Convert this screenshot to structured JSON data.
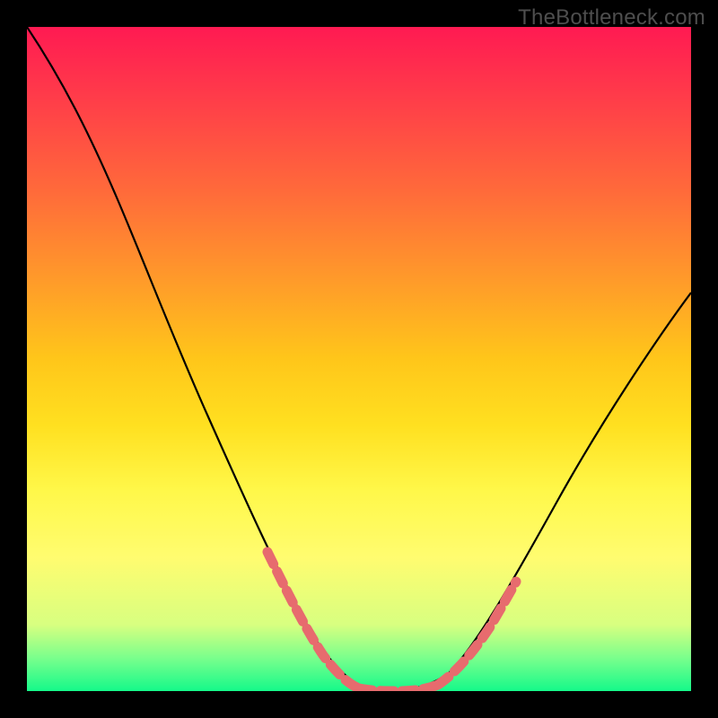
{
  "watermark": "TheBottleneck.com",
  "chart_data": {
    "type": "line",
    "title": "",
    "xlabel": "",
    "ylabel": "",
    "xlim": [
      0,
      100
    ],
    "ylim": [
      0,
      100
    ],
    "grid": false,
    "legend": false,
    "series": [
      {
        "name": "bottleneck-curve",
        "x": [
          0,
          5,
          10,
          15,
          20,
          25,
          30,
          35,
          40,
          45,
          50,
          55,
          60,
          65,
          70,
          75,
          80,
          85,
          90,
          95,
          100
        ],
        "y": [
          100,
          92,
          83,
          74,
          64,
          53,
          42,
          30,
          18,
          8,
          2,
          0,
          0,
          1,
          4,
          11,
          20,
          30,
          41,
          51,
          60
        ]
      }
    ],
    "highlight_segments": [
      {
        "name": "left-shoulder",
        "x_range": [
          36,
          48
        ],
        "note": "dotted red overlay on descending limb"
      },
      {
        "name": "valley-floor",
        "x_range": [
          48,
          62
        ],
        "note": "dotted red overlay across minimum"
      },
      {
        "name": "right-shoulder",
        "x_range": [
          62,
          72
        ],
        "note": "dotted red overlay on ascending limb"
      }
    ],
    "colors": {
      "curve": "#000000",
      "highlight": "#e76b6e",
      "background_top": "#ff1a52",
      "background_bottom": "#15f98a",
      "frame": "#000000"
    }
  }
}
